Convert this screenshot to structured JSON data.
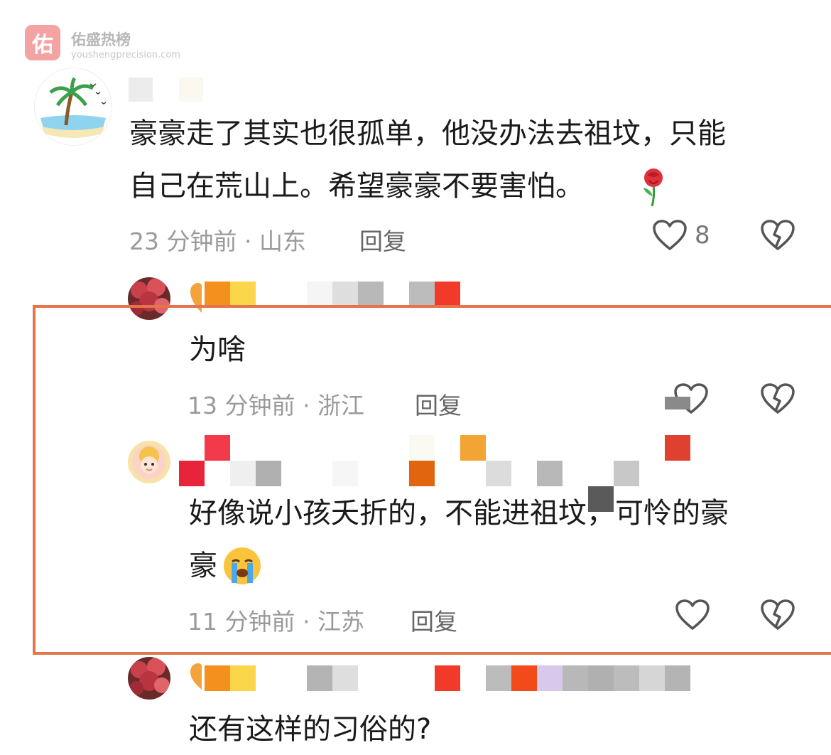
{
  "watermark": {
    "logo_char": "佑",
    "title": "佑盛热榜",
    "subtitle": "youshengprecision.com"
  },
  "comments": [
    {
      "text_line1": "豪豪走了其实也很孤单，他没办法去祖坟，只能",
      "text_line2": "自己在荒山上。希望豪豪不要害怕。",
      "emoji": "rose",
      "time": "23 分钟前 · 山东",
      "reply_label": "回复",
      "likes": "8",
      "avatar_icon": "palm-tree-beach-avatar"
    },
    {
      "text": "为啥",
      "time": "13 分钟前 · 浙江",
      "reply_label": "回复",
      "avatar_icon": "flower-tree-avatar"
    },
    {
      "text_line1": "好像说小孩夭折的，不能进祖坟，可怜的豪",
      "text_line2": "豪",
      "emoji": "loudly-crying-face",
      "time": "11 分钟前 · 江苏",
      "reply_label": "回复",
      "avatar_icon": "cartoon-girl-avatar"
    },
    {
      "text": "还有这样的习俗的?",
      "avatar_icon": "flower-tree-avatar"
    }
  ],
  "colors": {
    "highlight_border": "#e4744c",
    "meta_text": "#9a9a9a"
  }
}
